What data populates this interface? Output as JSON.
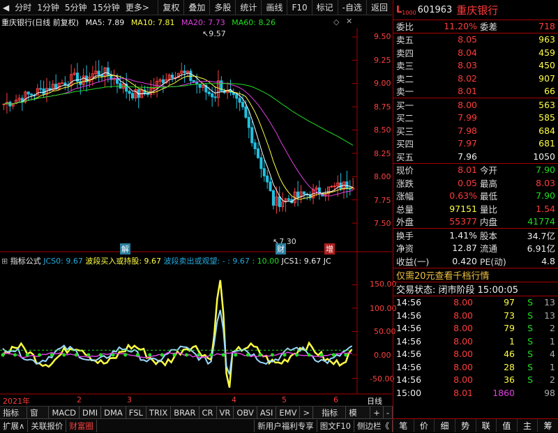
{
  "toolbar": {
    "left": [
      "分时",
      "1分钟",
      "5分钟",
      "15分钟",
      "更多>"
    ],
    "right": [
      "复权",
      "叠加",
      "多股",
      "统计",
      "画线",
      "F10",
      "标记",
      "-自选",
      "返回"
    ]
  },
  "kline_info": {
    "name": "重庆银行(日线 前复权)",
    "ma5": "MA5: 7.89",
    "ma10": "MA10: 7.81",
    "ma20": "MA20: 7.73",
    "ma60": "MA60: 8.26"
  },
  "indicator_info": {
    "name": "指标公式",
    "jcs0": "JCS0: 9.67",
    "buy": "波段买入或持股: 9.67",
    "sell": "波段卖出或观望: - : 9.67",
    "v10": ": 10.00",
    "jcs1": "JCS1: 9.67 JC"
  },
  "price_axis": [
    "9.50",
    "9.25",
    "9.00",
    "8.75",
    "8.50",
    "8.25",
    "8.00",
    "7.75",
    "7.50"
  ],
  "ind_axis": [
    "150.00",
    "100.00",
    "50.00",
    "0.00",
    "-50.00"
  ],
  "annotations": {
    "high": "9.57",
    "low": "7.30",
    "jie": "解",
    "cai": "财",
    "zeng": "增"
  },
  "time_axis": {
    "year": "2021年",
    "m2": "2",
    "m3": "3",
    "m4": "4",
    "m5": "5",
    "m6": "6",
    "period": "日线"
  },
  "tabs": [
    "指标A",
    "窗口",
    "MACD",
    "DMI",
    "DMA",
    "FSL",
    "TRIX",
    "BRAR",
    "CR",
    "VR",
    "OBV",
    "ASI",
    "EMV",
    ">",
    "指标B",
    "模 板",
    "+",
    "-"
  ],
  "bottom": {
    "expand": "扩展∧",
    "related": "关联报价",
    "caifu": "财富圈",
    "promo": "新用户福利专享",
    "f10": "图文F10",
    "sidebar": "侧边栏《"
  },
  "stock": {
    "code": "601963",
    "name": "重庆银行",
    "tag": "L",
    "sub": "1000"
  },
  "weibi": {
    "label1": "委比",
    "val1": "11.20%",
    "label2": "委差",
    "val2": "718"
  },
  "sells": [
    {
      "label": "卖五",
      "price": "8.05",
      "vol": "963"
    },
    {
      "label": "卖四",
      "price": "8.04",
      "vol": "459"
    },
    {
      "label": "卖三",
      "price": "8.03",
      "vol": "450"
    },
    {
      "label": "卖二",
      "price": "8.02",
      "vol": "907"
    },
    {
      "label": "卖一",
      "price": "8.01",
      "vol": "66"
    }
  ],
  "buys": [
    {
      "label": "买一",
      "price": "8.00",
      "vol": "563"
    },
    {
      "label": "买二",
      "price": "7.99",
      "vol": "585"
    },
    {
      "label": "买三",
      "price": "7.98",
      "vol": "684"
    },
    {
      "label": "买四",
      "price": "7.97",
      "vol": "681"
    },
    {
      "label": "买五",
      "price": "7.96",
      "vol": "1050"
    }
  ],
  "quote": [
    {
      "l1": "现价",
      "v1": "8.01",
      "l2": "今开",
      "v2": "7.90"
    },
    {
      "l1": "涨跌",
      "v1": "0.05",
      "l2": "最高",
      "v2": "8.03"
    },
    {
      "l1": "涨幅",
      "v1": "0.63%",
      "l2": "最低",
      "v2": "7.90"
    },
    {
      "l1": "总量",
      "v1": "97151",
      "l2": "量比",
      "v2": "1.54"
    },
    {
      "l1": "外盘",
      "v1": "55377",
      "l2": "内盘",
      "v2": "41774"
    }
  ],
  "stats": [
    {
      "l1": "换手",
      "v1": "1.41%",
      "l2": "股本",
      "v2": "34.7亿"
    },
    {
      "l1": "净资",
      "v1": "12.87",
      "l2": "流通",
      "v2": "6.91亿"
    },
    {
      "l1": "收益(一)",
      "v1": "0.420",
      "l2": "PE(动)",
      "v2": "4.8"
    }
  ],
  "promo_line": "仅需20元查看千档行情",
  "status_line": "交易状态: 闭市阶段 15:00:05",
  "ticks": [
    {
      "t": "14:56",
      "p": "8.00",
      "v": "97",
      "s": "S",
      "n": "13"
    },
    {
      "t": "14:56",
      "p": "8.00",
      "v": "73",
      "s": "S",
      "n": "13"
    },
    {
      "t": "14:56",
      "p": "8.00",
      "v": "79",
      "s": "S",
      "n": "2"
    },
    {
      "t": "14:56",
      "p": "8.00",
      "v": "1",
      "s": "S",
      "n": "1"
    },
    {
      "t": "14:56",
      "p": "8.00",
      "v": "46",
      "s": "S",
      "n": "4"
    },
    {
      "t": "14:56",
      "p": "8.00",
      "v": "28",
      "s": "S",
      "n": "1"
    },
    {
      "t": "14:56",
      "p": "8.00",
      "v": "36",
      "s": "S",
      "n": "2"
    },
    {
      "t": "15:00",
      "p": "8.01",
      "v": "1860",
      "s": "",
      "n": "98"
    }
  ],
  "rtabs": [
    "笔",
    "价",
    "细",
    "势",
    "联",
    "值",
    "主",
    "筹"
  ]
}
